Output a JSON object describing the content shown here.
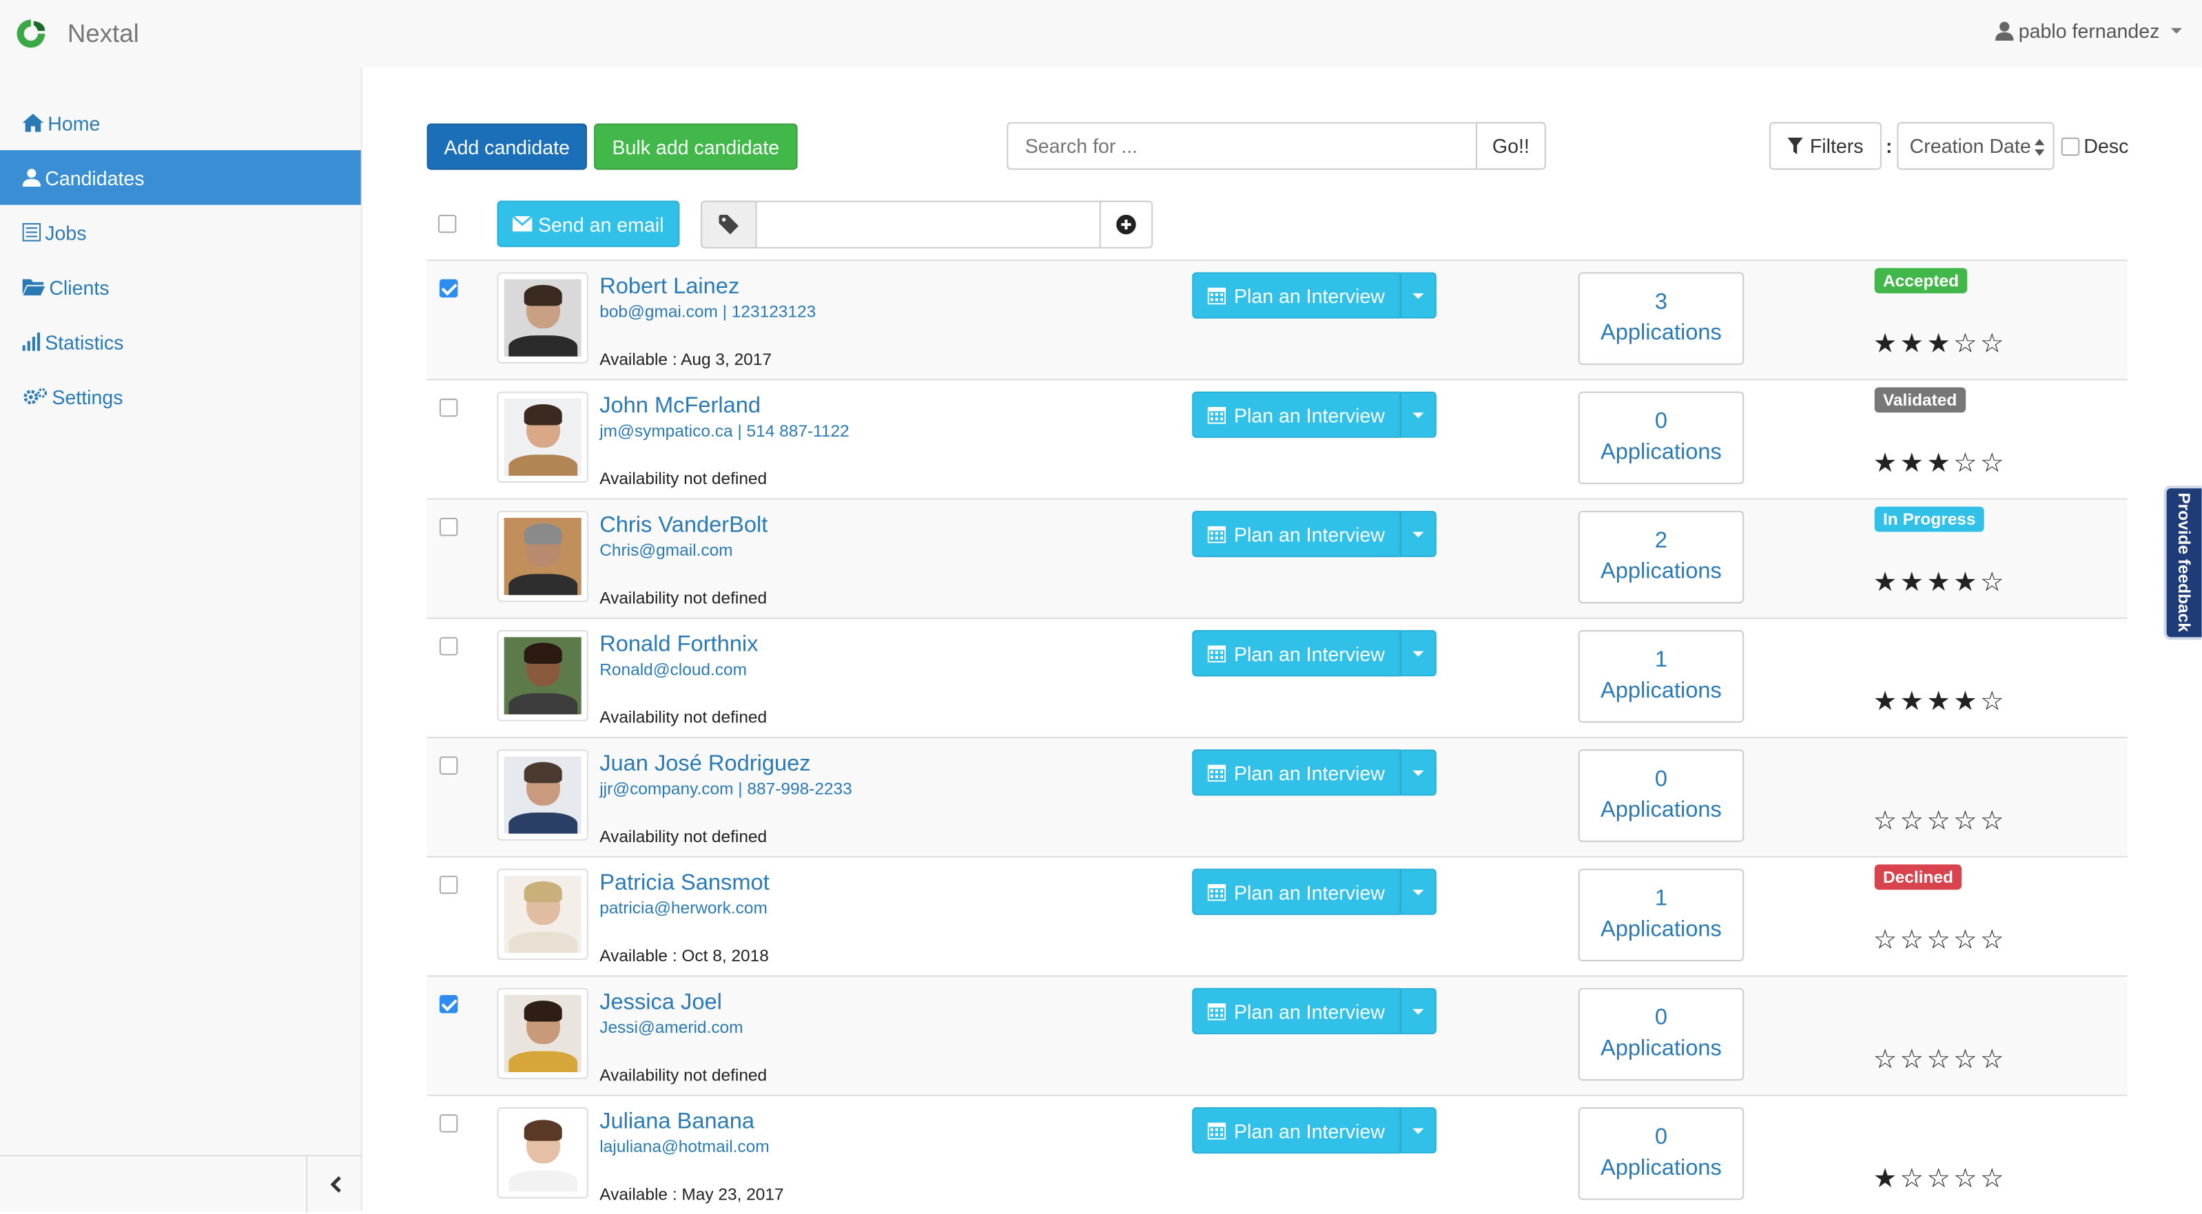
{
  "header": {
    "brand": "Nextal",
    "user": "pablo fernandez"
  },
  "sidebar": {
    "items": [
      {
        "label": "Home",
        "icon": "home-icon"
      },
      {
        "label": "Candidates",
        "icon": "user-icon"
      },
      {
        "label": "Jobs",
        "icon": "list-icon"
      },
      {
        "label": "Clients",
        "icon": "folder-icon"
      },
      {
        "label": "Statistics",
        "icon": "bar-chart-icon"
      },
      {
        "label": "Settings",
        "icon": "gear-icon"
      }
    ],
    "active_index": 1
  },
  "toolbar": {
    "add_label": "Add candidate",
    "bulk_label": "Bulk add candidate",
    "search_placeholder": "Search for ...",
    "search_go": "Go!!",
    "filters_label": "Filters",
    "sort_separator": ":",
    "sort_value": "Creation Date",
    "desc_label": "Desc",
    "send_email_label": "Send an email",
    "tag_input_value": ""
  },
  "candidates": [
    {
      "name": "Robert Lainez",
      "contact": "bob@gmai.com | 123123123",
      "availability": "Available : Aug 3, 2017",
      "applications_count": "3",
      "applications_label": "Applications",
      "status": "Accepted",
      "status_color": "#43b84a",
      "rating": 3,
      "checked": true,
      "skin": "#c9a083",
      "hair": "#3b2a20",
      "shirt": "#2b2b2b",
      "bg": "#d9d9d9"
    },
    {
      "name": "John McFerland",
      "contact": "jm@sympatico.ca | 514 887-1122",
      "availability": "Availability not defined",
      "applications_count": "0",
      "applications_label": "Applications",
      "status": "Validated",
      "status_color": "#777777",
      "rating": 3,
      "checked": false,
      "skin": "#d8a888",
      "hair": "#3b2a20",
      "shirt": "#b28555",
      "bg": "#eef0f2"
    },
    {
      "name": "Chris VanderBolt",
      "contact": "Chris@gmail.com",
      "availability": "Availability not defined",
      "applications_count": "2",
      "applications_label": "Applications",
      "status": "In Progress",
      "status_color": "#30c0e8",
      "rating": 4,
      "checked": false,
      "skin": "#b88a6e",
      "hair": "#8a8a8a",
      "shirt": "#2e2e2e",
      "bg": "#c08f5c"
    },
    {
      "name": "Ronald Forthnix",
      "contact": "Ronald@cloud.com",
      "availability": "Availability not defined",
      "applications_count": "1",
      "applications_label": "Applications",
      "status": "",
      "status_color": "",
      "rating": 4,
      "checked": false,
      "skin": "#8a5a3e",
      "hair": "#2a1a12",
      "shirt": "#3c3c3c",
      "bg": "#5d7a4a"
    },
    {
      "name": "Juan José Rodriguez",
      "contact": "jjr@company.com | 887-998-2233",
      "availability": "Availability not defined",
      "applications_count": "0",
      "applications_label": "Applications",
      "status": "",
      "status_color": "",
      "rating": 0,
      "checked": false,
      "skin": "#c99a7e",
      "hair": "#4a3a30",
      "shirt": "#2a3f66",
      "bg": "#e6e9ee"
    },
    {
      "name": "Patricia Sansmot",
      "contact": "patricia@herwork.com",
      "availability": "Available : Oct 8, 2018",
      "applications_count": "1",
      "applications_label": "Applications",
      "status": "Declined",
      "status_color": "#d9434e",
      "rating": 0,
      "checked": false,
      "skin": "#e0bda0",
      "hair": "#c9b07a",
      "shirt": "#e8e0d2",
      "bg": "#f3efe8"
    },
    {
      "name": "Jessica Joel",
      "contact": "Jessi@amerid.com",
      "availability": "Availability not defined",
      "applications_count": "0",
      "applications_label": "Applications",
      "status": "",
      "status_color": "",
      "rating": 0,
      "checked": true,
      "skin": "#c99a7a",
      "hair": "#2e1e16",
      "shirt": "#d6a63a",
      "bg": "#e9e4de"
    },
    {
      "name": "Juliana Banana",
      "contact": "lajuliana@hotmail.com",
      "availability": "Available : May 23, 2017",
      "applications_count": "0",
      "applications_label": "Applications",
      "status": "",
      "status_color": "",
      "rating": 1,
      "checked": false,
      "skin": "#e5c0a6",
      "hair": "#5a3a26",
      "shirt": "#f2f2f2",
      "bg": "#ffffff"
    }
  ],
  "plan_label": "Plan an Interview",
  "feedback_label": "Provide feedback"
}
